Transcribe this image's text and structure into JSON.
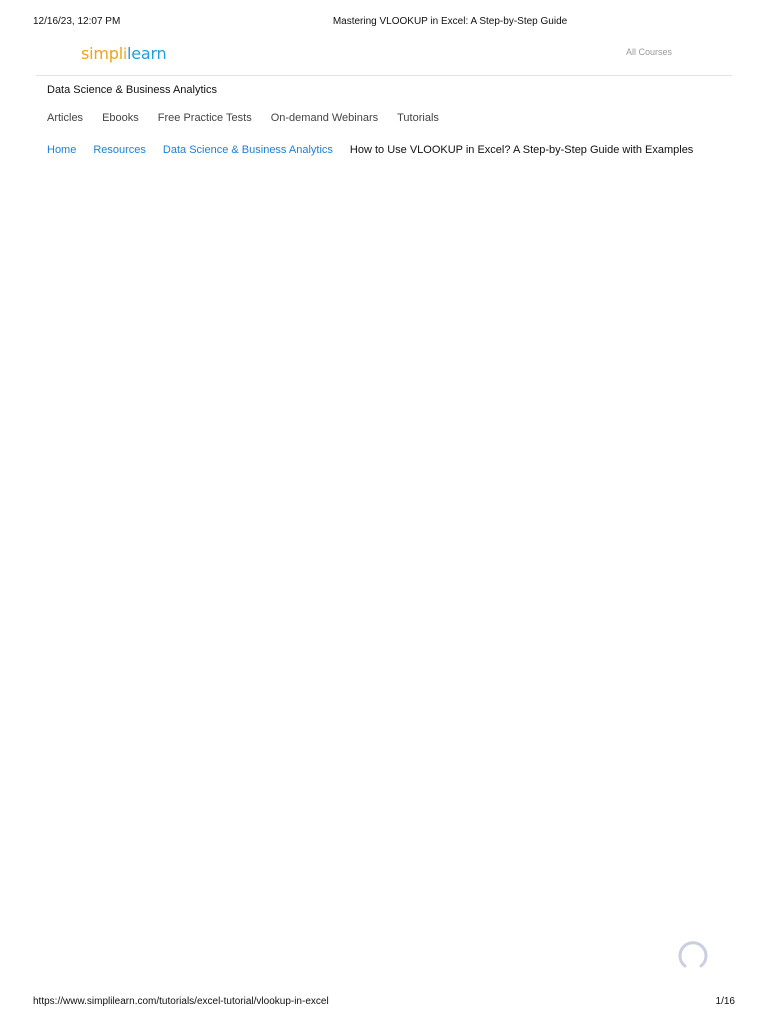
{
  "print_header": {
    "datetime": "12/16/23, 12:07 PM",
    "title": "Mastering VLOOKUP in Excel: A Step-by-Step Guide"
  },
  "header": {
    "logo": {
      "part1": "simpl",
      "separator": "i",
      "part2": "learn"
    },
    "all_courses_label": "All Courses"
  },
  "section_title": "Data Science & Business Analytics",
  "subnav": {
    "items": [
      "Articles",
      "Ebooks",
      "Free Practice Tests",
      "On-demand Webinars",
      "Tutorials"
    ]
  },
  "breadcrumb": {
    "links": [
      "Home",
      "Resources",
      "Data Science & Business Analytics"
    ],
    "current": "How to Use VLOOKUP in Excel? A Step-by-Step Guide with Examples"
  },
  "print_footer": {
    "url": "https://www.simplilearn.com/tutorials/excel-tutorial/vlookup-in-excel",
    "page_indicator": "1/16"
  },
  "icons": {
    "loading": "loading-spinner-icon"
  },
  "colors": {
    "logo_orange": "#f0a31c",
    "logo_blue": "#1d9fd8",
    "link_blue": "#1d7fd6"
  }
}
